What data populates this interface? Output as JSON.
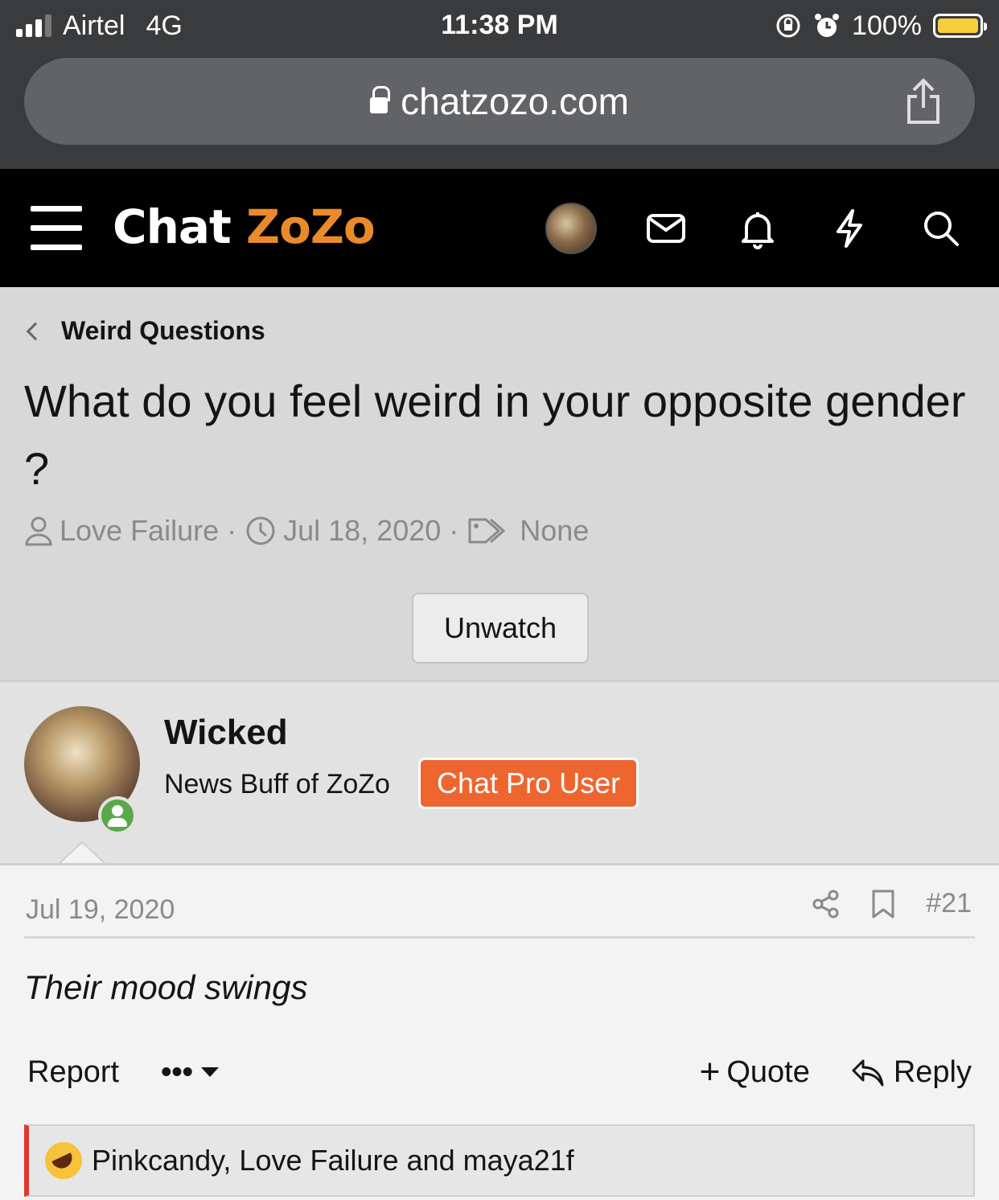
{
  "status_bar": {
    "carrier": "Airtel",
    "network": "4G",
    "time": "11:38 PM",
    "battery": "100%",
    "battery_level": 1.0
  },
  "browser": {
    "url": "chatzozo.com"
  },
  "header": {
    "logo_part1": "Chat",
    "logo_part2": "ZoZo",
    "icons": [
      "menu-icon",
      "avatar",
      "mail-icon",
      "bell-icon",
      "lightning-icon",
      "search-icon"
    ]
  },
  "thread": {
    "breadcrumb": "Weird Questions",
    "title": "What do you feel weird in your opposite gender ?",
    "author": "Love Failure",
    "date": "Jul 18, 2020",
    "tags": "None",
    "watch_button": "Unwatch"
  },
  "post": {
    "username": "Wicked",
    "user_title": "News Buff of ZoZo",
    "badge": "Chat Pro User",
    "date": "Jul 19, 2020",
    "number": "#21",
    "message": "Their mood swings",
    "actions": {
      "report": "Report",
      "more": "•••",
      "quote": "Quote",
      "reply": "Reply"
    },
    "reactions": "Pinkcandy, Love Failure and maya21f"
  },
  "colors": {
    "accent": "#ef6530",
    "logo_orange": "#ea8a2a",
    "online": "#5aa84a",
    "reaction_bar": "#e0362c"
  }
}
